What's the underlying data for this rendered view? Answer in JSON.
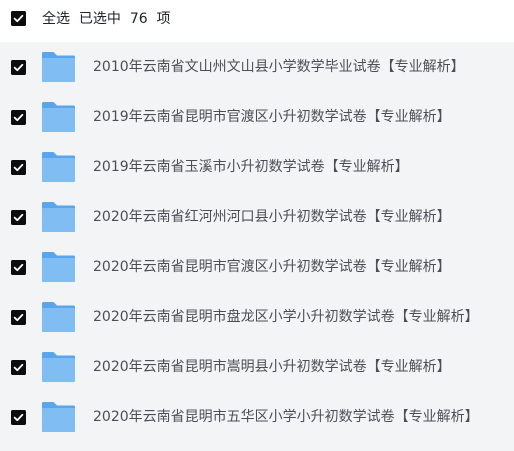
{
  "header": {
    "select_all_label": "全选",
    "selected_prefix": "已选中",
    "selected_count": "76",
    "selected_suffix": "项"
  },
  "files": [
    {
      "name": "2010年云南省文山州文山县小学数学毕业试卷【专业解析】",
      "checked": true,
      "icon": "folder-icon"
    },
    {
      "name": "2019年云南省昆明市官渡区小升初数学试卷【专业解析】",
      "checked": true,
      "icon": "folder-icon"
    },
    {
      "name": "2019年云南省玉溪市小升初数学试卷【专业解析】",
      "checked": true,
      "icon": "folder-icon"
    },
    {
      "name": "2020年云南省红河州河口县小升初数学试卷【专业解析】",
      "checked": true,
      "icon": "folder-icon"
    },
    {
      "name": "2020年云南省昆明市官渡区小升初数学试卷【专业解析】",
      "checked": true,
      "icon": "folder-icon"
    },
    {
      "name": "2020年云南省昆明市盘龙区小学小升初数学试卷【专业解析】",
      "checked": true,
      "icon": "folder-icon"
    },
    {
      "name": "2020年云南省昆明市嵩明县小升初数学试卷【专业解析】",
      "checked": true,
      "icon": "folder-icon"
    },
    {
      "name": "2020年云南省昆明市五华区小学小升初数学试卷【专业解析】",
      "checked": true,
      "icon": "folder-icon"
    }
  ],
  "colors": {
    "checkbox": "#0c0c0c",
    "list_background": "#f3f4f6",
    "folder_front": "#7fbdf3",
    "folder_back": "#5aa6ec"
  }
}
